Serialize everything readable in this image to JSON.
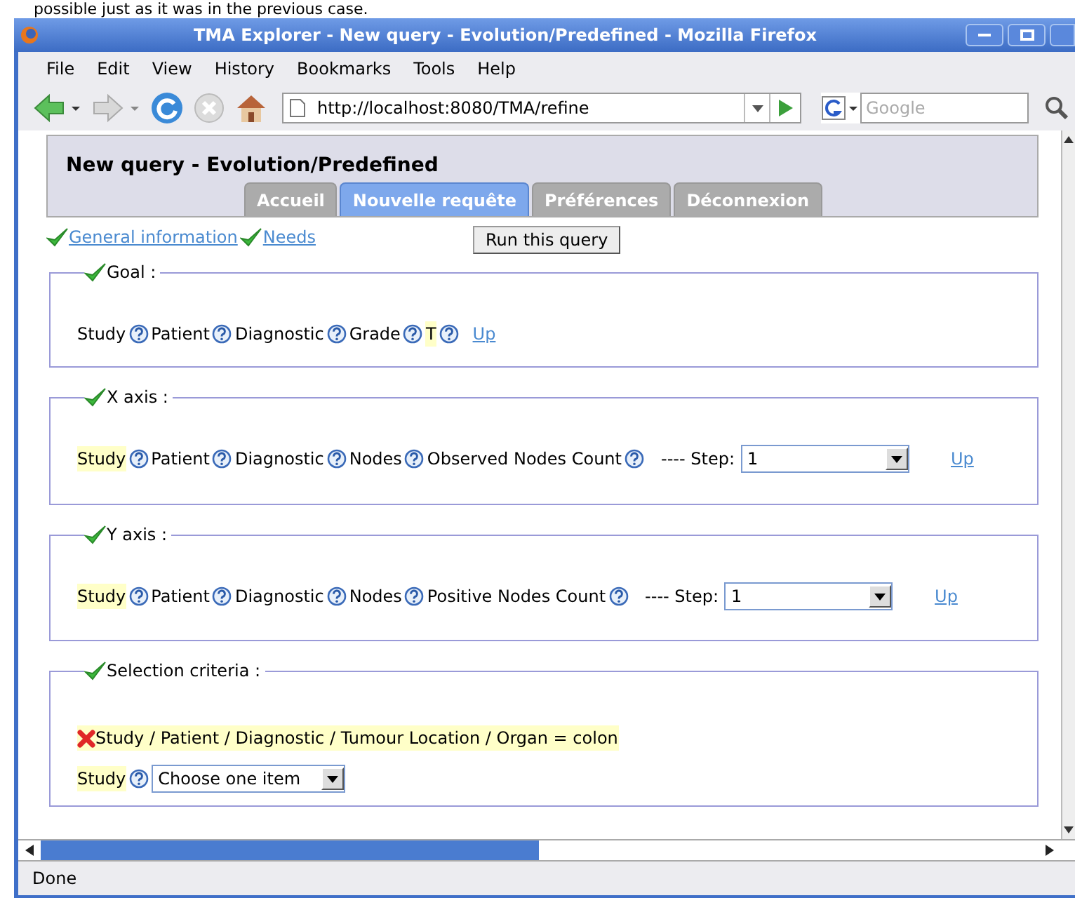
{
  "document_text": "possible just as it was in the previous case.",
  "window": {
    "title": "TMA Explorer - New query - Evolution/Predefined - Mozilla Firefox"
  },
  "menu": [
    "File",
    "Edit",
    "View",
    "History",
    "Bookmarks",
    "Tools",
    "Help"
  ],
  "address": "http://localhost:8080/TMA/refine",
  "search": {
    "placeholder": "Google"
  },
  "page": {
    "title": "New query - Evolution/Predefined",
    "tabs": [
      {
        "label": "Accueil",
        "selected": false
      },
      {
        "label": "Nouvelle requête",
        "selected": true
      },
      {
        "label": "Préférences",
        "selected": false
      },
      {
        "label": "Déconnexion",
        "selected": false
      }
    ],
    "steps": [
      {
        "label": "General information",
        "done": true
      },
      {
        "label": "Needs",
        "done": true
      }
    ],
    "run_button": "Run this query",
    "sections": [
      {
        "kind": "path",
        "legend": "Goal :",
        "done": true,
        "fields": [
          {
            "label": "Study",
            "highlighted": false
          },
          {
            "label": "Patient",
            "highlighted": false
          },
          {
            "label": "Diagnostic",
            "highlighted": false
          },
          {
            "label": "Grade",
            "highlighted": false
          },
          {
            "label": "T",
            "highlighted": true
          }
        ],
        "up": "Up"
      },
      {
        "kind": "path",
        "legend": "X axis :",
        "done": true,
        "fields": [
          {
            "label": "Study",
            "highlighted": true
          },
          {
            "label": "Patient",
            "highlighted": false
          },
          {
            "label": "Diagnostic",
            "highlighted": false
          },
          {
            "label": "Nodes",
            "highlighted": false
          },
          {
            "label": "Observed Nodes Count",
            "highlighted": false
          }
        ],
        "step_label": "---- Step:",
        "step_value": "1",
        "up": "Up"
      },
      {
        "kind": "path",
        "legend": "Y axis :",
        "done": true,
        "fields": [
          {
            "label": "Study",
            "highlighted": true
          },
          {
            "label": "Patient",
            "highlighted": false
          },
          {
            "label": "Diagnostic",
            "highlighted": false
          },
          {
            "label": "Nodes",
            "highlighted": false
          },
          {
            "label": "Positive Nodes Count",
            "highlighted": false
          }
        ],
        "step_label": "---- Step:",
        "step_value": "1",
        "up": "Up"
      },
      {
        "kind": "criteria",
        "legend": "Selection criteria :",
        "done": true,
        "criteria": [
          {
            "text": "Study / Patient / Diagnostic / Tumour Location / Organ = colon",
            "valid": false
          }
        ],
        "fields": [
          {
            "label": "Study",
            "highlighted": true
          }
        ],
        "select_value": "Choose one item"
      }
    ]
  },
  "status": "Done"
}
